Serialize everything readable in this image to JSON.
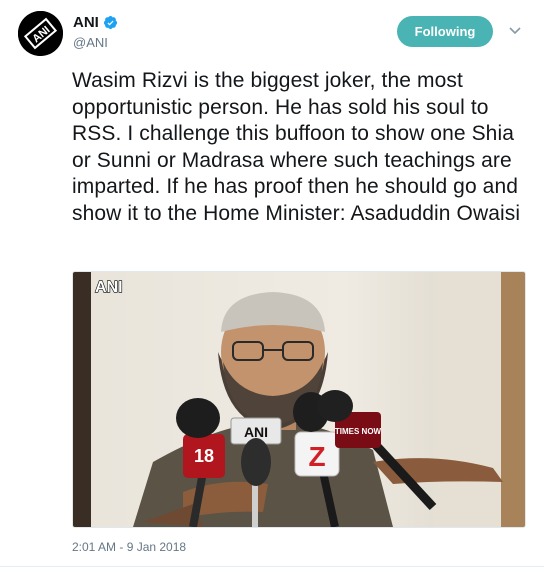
{
  "account": {
    "display_name": "ANI",
    "handle": "@ANI",
    "verified_icon": "verified-badge-icon",
    "avatar_label": "ANI"
  },
  "actions": {
    "follow_label": "Following",
    "more_icon": "chevron-down-icon"
  },
  "tweet": {
    "text": "Wasim Rizvi is the biggest joker, the most opportunistic person. He has sold his soul to RSS. I challenge this buffoon to show one Shia or Sunni or Madrasa where such teachings are imparted. If he has proof then he should go and show it to the Home Minister: Asaduddin Owaisi",
    "timestamp": "2:01 AM - 9 Jan 2018"
  },
  "media": {
    "watermark": "ANI",
    "mic_labels": [
      "18",
      "ANI",
      "Z",
      "TIMES NOW"
    ]
  },
  "colors": {
    "follow_button": "#4ab3b3",
    "verified": "#1da1f2",
    "secondary_text": "#657786"
  }
}
